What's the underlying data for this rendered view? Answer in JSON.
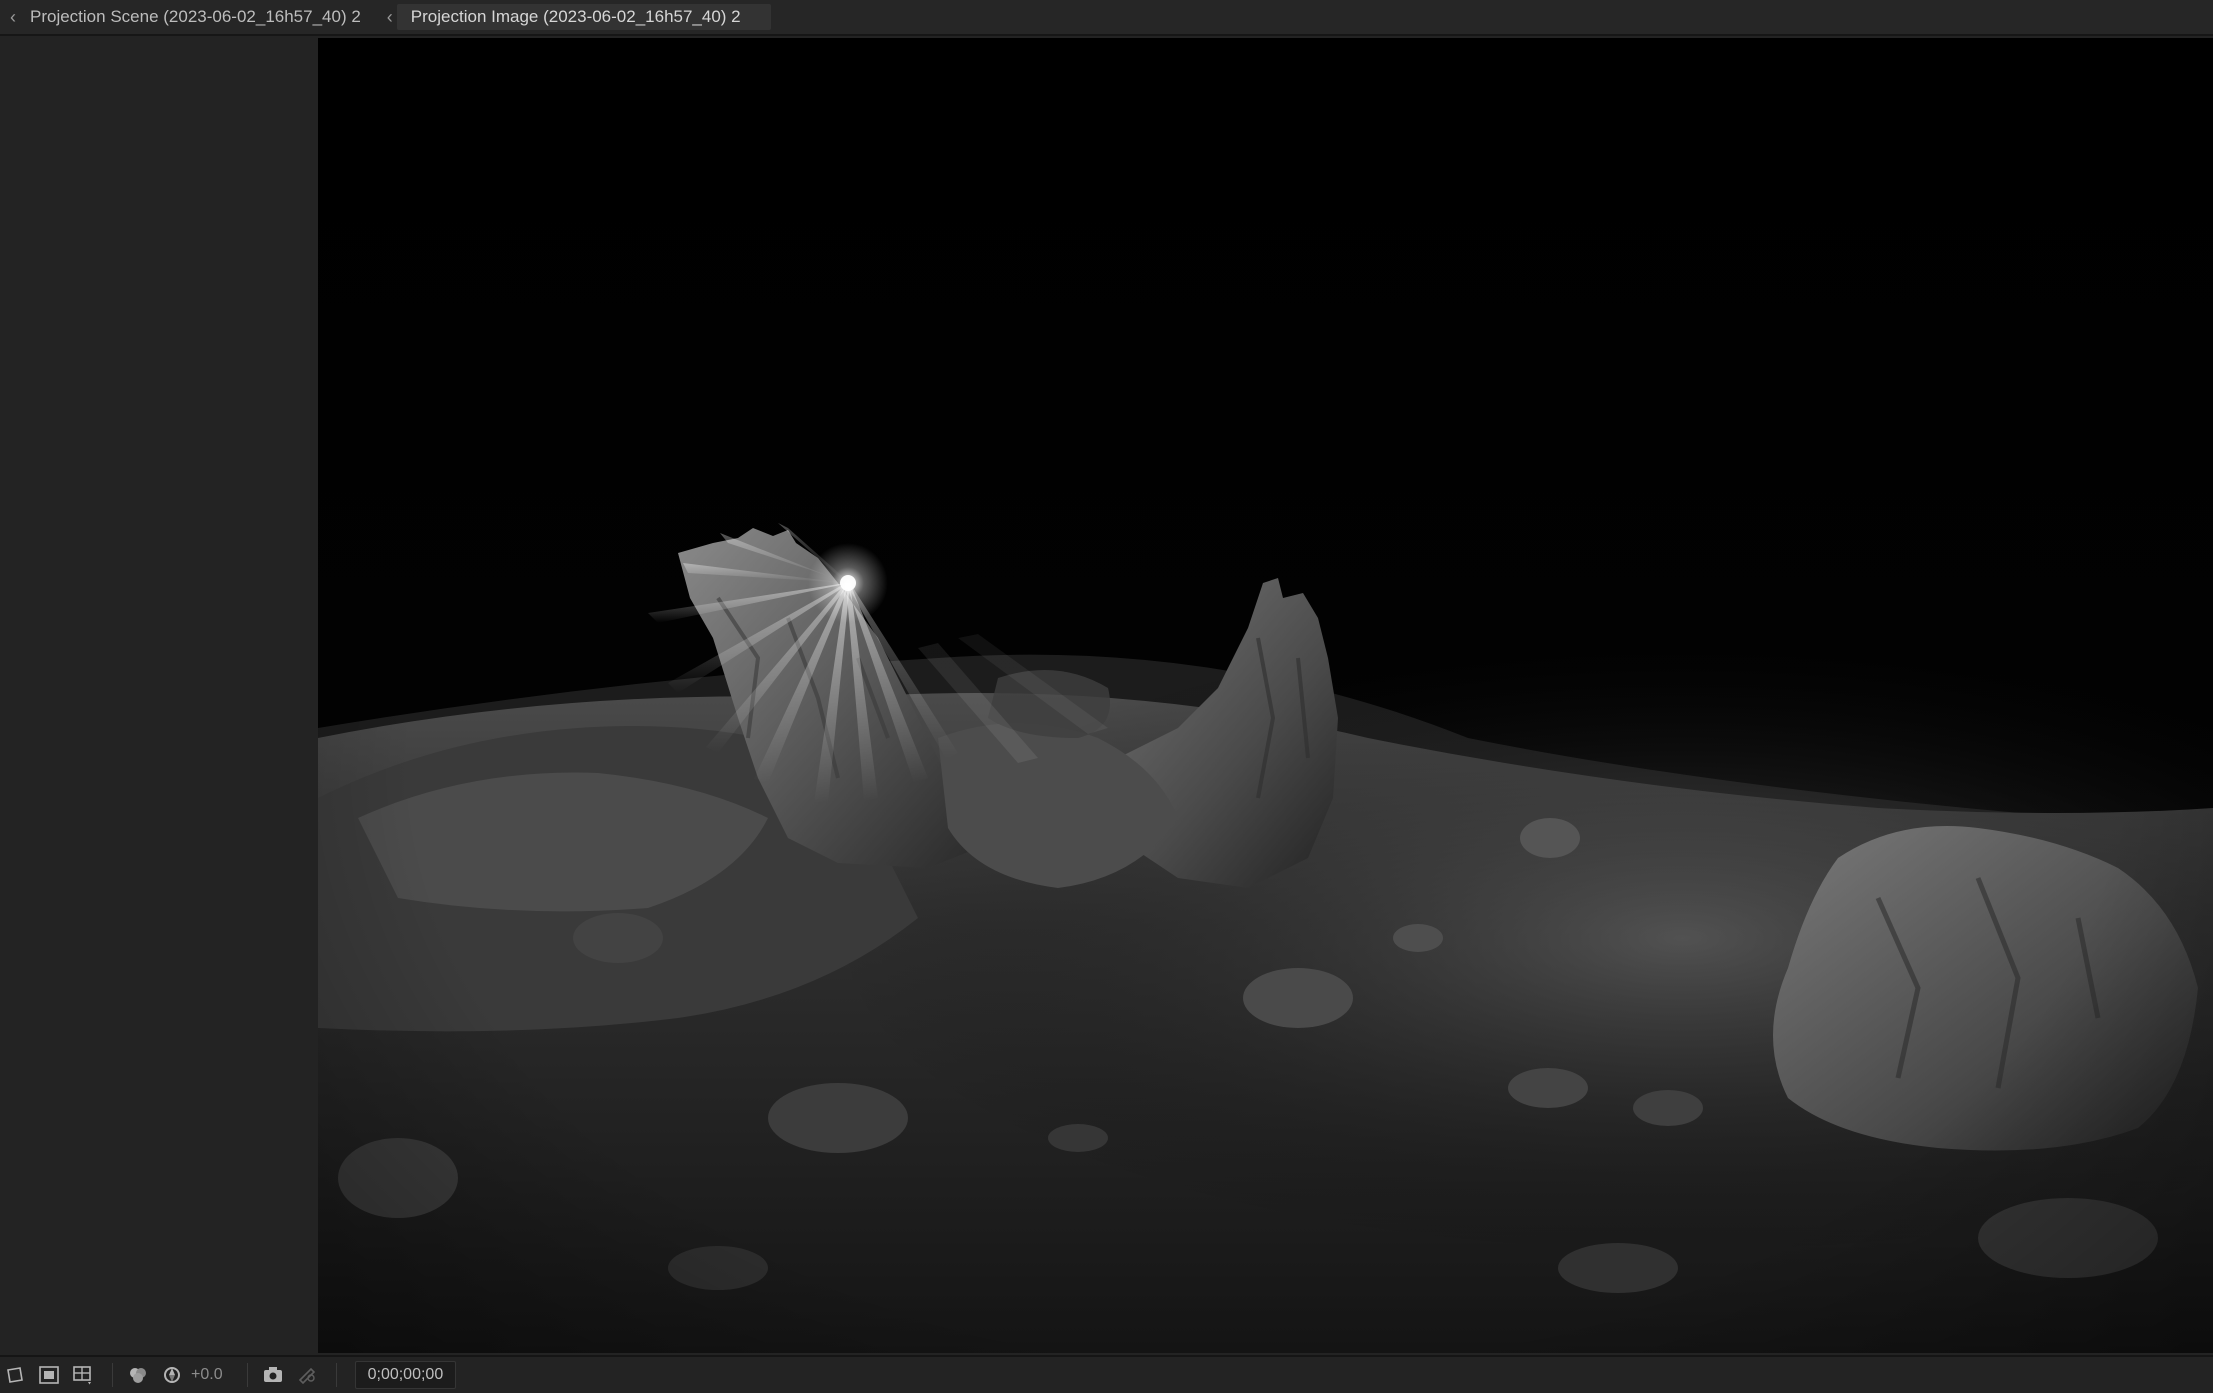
{
  "tabs": [
    {
      "label": "Projection Scene (2023-06-02_16h57_40) 2",
      "active": false
    },
    {
      "label": "Projection Image (2023-06-02_16h57_40) 2",
      "active": true
    }
  ],
  "viewer": {
    "content": "black-and-white rocky landscape at night with light rays"
  },
  "toolbar": {
    "exposure_value": "+0.0",
    "timecode": "0;00;00;00",
    "icons": [
      "region-of-interest-icon",
      "toggle-transparency-grid-icon",
      "guides-icon",
      "color-channel-icon",
      "reset-exposure-icon",
      "snapshot-camera-icon",
      "show-snapshot-icon"
    ]
  },
  "colors": {
    "panel_bg": "#232323",
    "tab_bar_bg": "#262626",
    "active_tab_bg": "#333333",
    "text": "#bdbdbd"
  }
}
